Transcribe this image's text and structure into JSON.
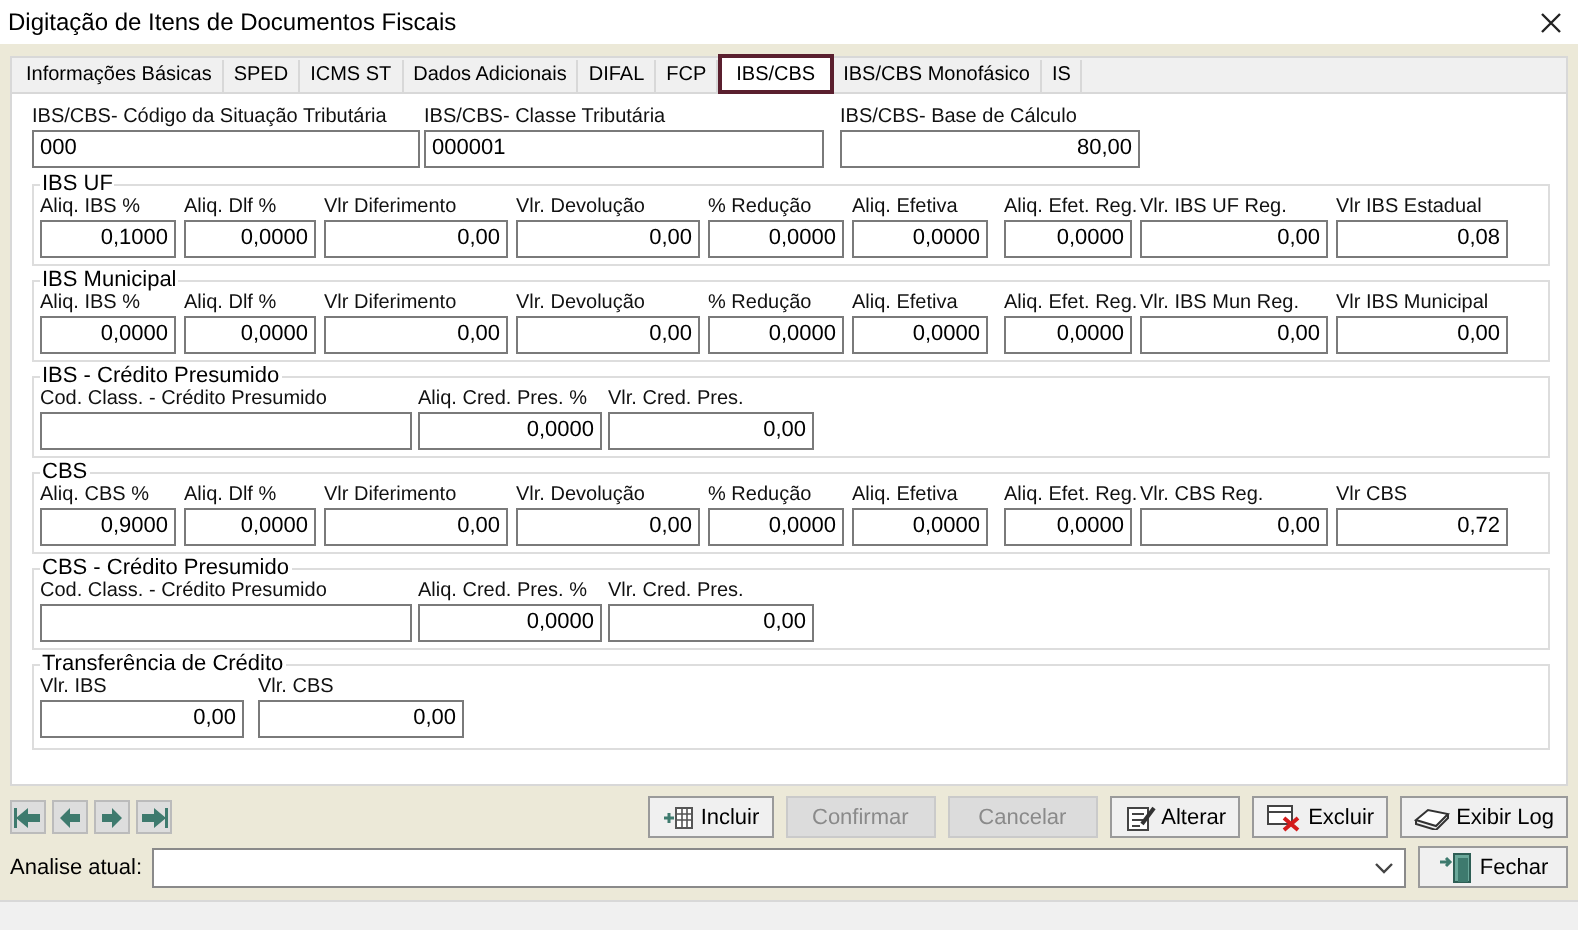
{
  "window": {
    "title": "Digitação de Itens de Documentos Fiscais"
  },
  "tabs": [
    {
      "label": "Informações Básicas",
      "selected": false
    },
    {
      "label": "SPED",
      "selected": false
    },
    {
      "label": "ICMS ST",
      "selected": false
    },
    {
      "label": "Dados Adicionais",
      "selected": false
    },
    {
      "label": "DIFAL",
      "selected": false
    },
    {
      "label": "FCP",
      "selected": false
    },
    {
      "label": "IBS/CBS",
      "selected": true
    },
    {
      "label": "IBS/CBS Monofásico",
      "selected": false
    },
    {
      "label": "IS",
      "selected": false
    }
  ],
  "header_fields": [
    {
      "label": "IBS/CBS- Código da Situação Tributária",
      "value": "000",
      "kind": "code"
    },
    {
      "label": "IBS/CBS- Classe Tributária",
      "value": "000001",
      "kind": "code"
    },
    {
      "label": "IBS/CBS- Base de Cálculo",
      "value": "80,00",
      "kind": "amount"
    }
  ],
  "groups": [
    {
      "kind": "rates",
      "title": "IBS UF",
      "fields": [
        {
          "label": "Aliq. IBS %",
          "value": "0,1000"
        },
        {
          "label": "Aliq. Dlf %",
          "value": "0,0000"
        },
        {
          "label": "Vlr Diferimento",
          "value": "0,00"
        },
        {
          "label": "Vlr. Devolução",
          "value": "0,00"
        },
        {
          "label": "% Redução",
          "value": "0,0000"
        },
        {
          "label": "Aliq. Efetiva",
          "value": "0,0000"
        },
        {
          "label": "Aliq. Efet. Reg.",
          "value": "0,0000"
        },
        {
          "label": "Vlr. IBS UF Reg.",
          "value": "0,00"
        },
        {
          "label": "Vlr IBS Estadual",
          "value": "0,08"
        }
      ]
    },
    {
      "kind": "rates",
      "title": "IBS Municipal",
      "fields": [
        {
          "label": "Aliq. IBS %",
          "value": "0,0000"
        },
        {
          "label": "Aliq. Dlf %",
          "value": "0,0000"
        },
        {
          "label": "Vlr Diferimento",
          "value": "0,00"
        },
        {
          "label": "Vlr. Devolução",
          "value": "0,00"
        },
        {
          "label": "% Redução",
          "value": "0,0000"
        },
        {
          "label": "Aliq. Efetiva",
          "value": "0,0000"
        },
        {
          "label": "Aliq. Efet. Reg.",
          "value": "0,0000"
        },
        {
          "label": "Vlr. IBS Mun Reg.",
          "value": "0,00"
        },
        {
          "label": "Vlr IBS Municipal",
          "value": "0,00"
        }
      ]
    },
    {
      "kind": "credit",
      "title": "IBS - Crédito Presumido",
      "fields": [
        {
          "label": "Cod. Class. - Crédito Presumido"
        },
        {
          "label": "Aliq. Cred. Pres. %",
          "value": "0,0000"
        },
        {
          "label": "Vlr. Cred. Pres.",
          "value": "0,00"
        }
      ]
    },
    {
      "kind": "rates",
      "title": "CBS",
      "fields": [
        {
          "label": "Aliq. CBS %",
          "value": "0,9000"
        },
        {
          "label": "Aliq. Dlf %",
          "value": "0,0000"
        },
        {
          "label": "Vlr Diferimento",
          "value": "0,00"
        },
        {
          "label": "Vlr. Devolução",
          "value": "0,00"
        },
        {
          "label": "% Redução",
          "value": "0,0000"
        },
        {
          "label": "Aliq. Efetiva",
          "value": "0,0000"
        },
        {
          "label": "Aliq. Efet. Reg.",
          "value": "0,0000"
        },
        {
          "label": "Vlr. CBS Reg.",
          "value": "0,00"
        },
        {
          "label": "Vlr CBS",
          "value": "0,72"
        }
      ]
    },
    {
      "kind": "credit",
      "title": "CBS - Crédito Presumido",
      "fields": [
        {
          "label": "Cod. Class. - Crédito Presumido"
        },
        {
          "label": "Aliq. Cred. Pres. %",
          "value": "0,0000"
        },
        {
          "label": "Vlr. Cred. Pres.",
          "value": "0,00"
        }
      ]
    },
    {
      "kind": "transfer",
      "title": "Transferência de Crédito",
      "fields": [
        {
          "label": "Vlr. IBS",
          "value": "0,00"
        },
        {
          "label": "Vlr. CBS",
          "value": "0,00"
        }
      ]
    }
  ],
  "actions": [
    {
      "label": "Incluir",
      "kind": "add",
      "disabled": false
    },
    {
      "label": "Confirmar",
      "kind": "confirm",
      "disabled": true
    },
    {
      "label": "Cancelar",
      "kind": "cancel",
      "disabled": true
    },
    {
      "label": "Alterar",
      "kind": "edit",
      "disabled": false
    },
    {
      "label": "Excluir",
      "kind": "delete",
      "disabled": false
    },
    {
      "label": "Exibir Log",
      "kind": "log",
      "disabled": false
    }
  ],
  "analysis": {
    "label": "Analise atual:"
  },
  "close_button": {
    "label": "Fechar"
  }
}
